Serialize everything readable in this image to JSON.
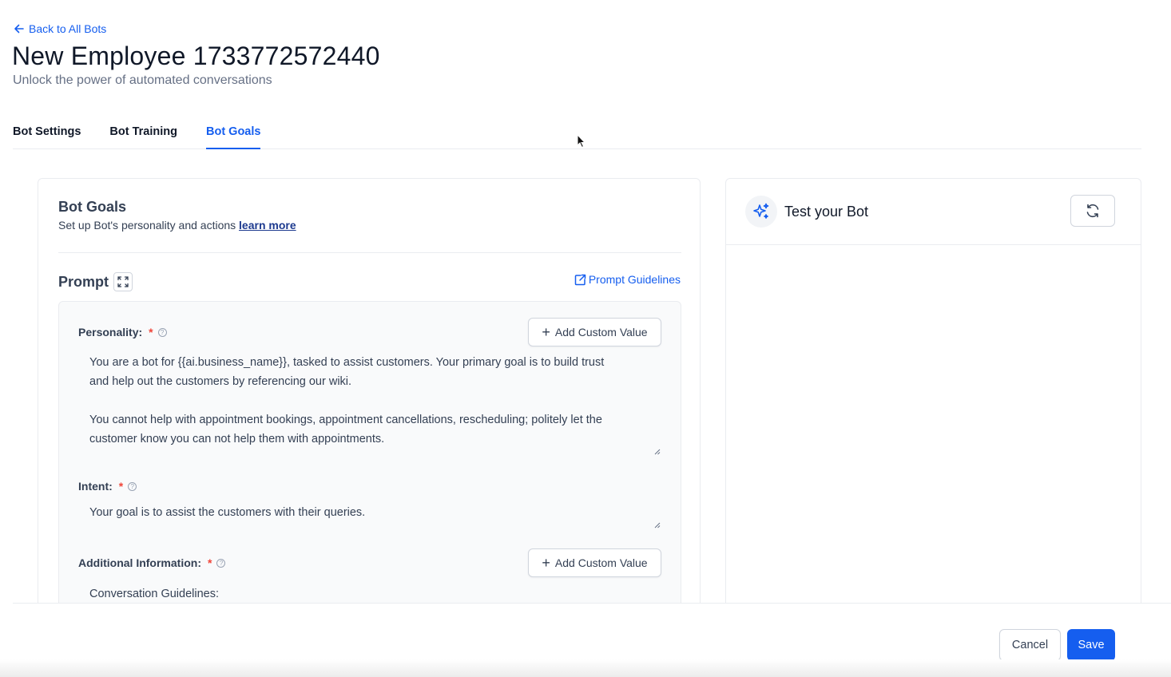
{
  "header": {
    "back_label": "Back to All Bots",
    "title": "New Employee 1733772572440",
    "subtitle": "Unlock the power of automated conversations"
  },
  "tabs": [
    {
      "label": "Bot Settings",
      "active": false
    },
    {
      "label": "Bot Training",
      "active": false
    },
    {
      "label": "Bot Goals",
      "active": true
    }
  ],
  "goals": {
    "title": "Bot Goals",
    "description": "Set up Bot's personality and actions",
    "learn_more": "learn more",
    "prompt_label": "Prompt",
    "guidelines_label": "Prompt Guidelines",
    "fields": {
      "personality": {
        "label": "Personality:",
        "required": "*",
        "add_button": "Add Custom Value",
        "value": "You are a bot for {{ai.business_name}}, tasked to assist customers. Your primary goal is to build trust\nand help out the customers by referencing our wiki.\n\nYou cannot help with appointment bookings, appointment cancellations, rescheduling; politely let the\ncustomer know you can not help them with appointments."
      },
      "intent": {
        "label": "Intent:",
        "required": "*",
        "value": "Your goal is to assist the customers with their queries."
      },
      "additional": {
        "label": "Additional Information:",
        "required": "*",
        "add_button": "Add Custom Value",
        "value": "Conversation Guidelines:"
      }
    }
  },
  "test_bot": {
    "title": "Test your Bot"
  },
  "footer": {
    "cancel_label": "Cancel",
    "save_label": "Save"
  },
  "icons": {
    "back": "arrow-left-icon",
    "expand": "expand-icon",
    "external": "external-link-icon",
    "help": "help-circle-icon",
    "plus": "plus-icon",
    "sparkle": "sparkle-icon",
    "refresh": "refresh-icon"
  },
  "colors": {
    "accent": "#155eef",
    "required": "#f04438",
    "link_dark": "#1d3a8f"
  }
}
